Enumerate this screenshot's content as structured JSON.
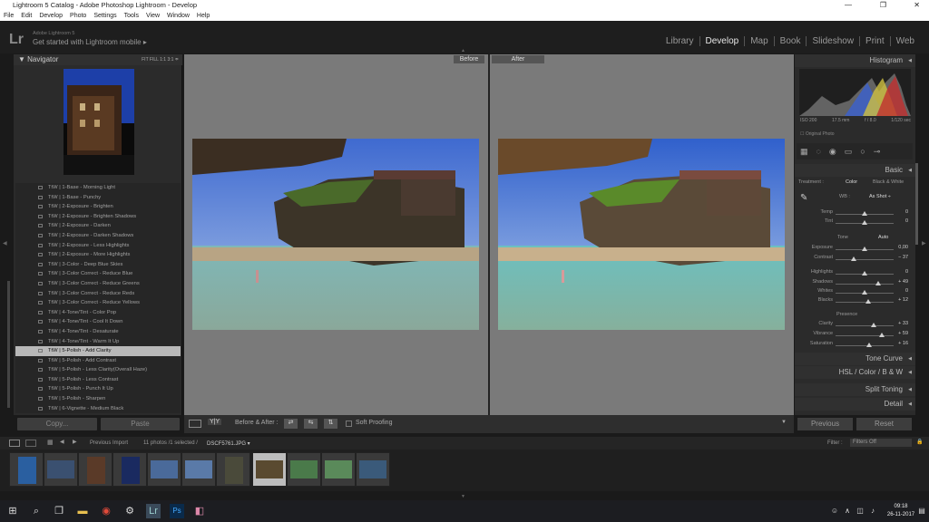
{
  "window": {
    "title": "Lightroom 5 Catalog - Adobe Photoshop Lightroom - Develop"
  },
  "menu": [
    "File",
    "Edit",
    "Develop",
    "Photo",
    "Settings",
    "Tools",
    "View",
    "Window",
    "Help"
  ],
  "identity": {
    "logo": "Lr",
    "small": "Adobe Lightroom 5",
    "main": "Get started with Lightroom mobile ▸"
  },
  "modules": [
    "Library",
    "Develop",
    "Map",
    "Book",
    "Slideshow",
    "Print",
    "Web"
  ],
  "navigator": {
    "title": "Navigator",
    "options": "FIT   FILL   1:1   3:1 ≑"
  },
  "presets": [
    "TtW | 1-Base - Morning Light",
    "TtW | 1-Base - Punchy",
    "TtW | 2-Exposure - Brighten",
    "TtW | 2-Exposure - Brighten Shadows",
    "TtW | 2-Exposure - Darken",
    "TtW | 2-Exposure - Darken Shadows",
    "TtW | 2-Exposure - Less Highlights",
    "TtW | 2-Exposure - More Highlights",
    "TtW | 3-Color - Deep Blue Skies",
    "TtW | 3-Color Correct - Reduce Blue",
    "TtW | 3-Color Correct - Reduce Greens",
    "TtW | 3-Color Correct - Reduce Reds",
    "TtW | 3-Color Correct - Reduce Yellows",
    "TtW | 4-Tone/Tint - Color Pop",
    "TtW | 4-Tone/Tint - Cool It Down",
    "TtW | 4-Tone/Tint - Desaturate",
    "TtW | 4-Tone/Tint - Warm It Up",
    "TtW | 5-Polish - Add Clarity",
    "TtW | 5-Polish - Add Contrast",
    "TtW | 5-Polish - Less Clarity(Overall Haze)",
    "TtW | 5-Polish - Less Contrast",
    "TtW | 5-Polish - Punch It Up",
    "TtW | 5-Polish - Sharpen",
    "TtW | 6-Vignette - Medium Black"
  ],
  "selected_preset": "TtW | 5-Polish - Add Clarity",
  "left_buttons": {
    "copy": "Copy...",
    "paste": "Paste"
  },
  "view_labels": {
    "before": "Before",
    "after": "After"
  },
  "toolbar": {
    "mode": "Y|Y",
    "before_after": "Before & After :",
    "soft_proofing": "Soft Proofing"
  },
  "histogram": {
    "title": "Histogram",
    "iso": "ISO 200",
    "focal": "17.5 mm",
    "aperture": "f / 8.0",
    "shutter": "1/120 sec",
    "original_photo": "Original Photo"
  },
  "basic": {
    "title": "Basic",
    "treatment_label": "Treatment :",
    "treatment_color": "Color",
    "treatment_bw": "Black & White",
    "wb_label": "WB :",
    "wb_value": "As Shot ÷",
    "tone_label": "Tone",
    "auto_label": "Auto",
    "presence_label": "Presence"
  },
  "sliders": [
    {
      "label": "Temp",
      "value": "0",
      "pos": 0.5
    },
    {
      "label": "Tint",
      "value": "0",
      "pos": 0.5
    },
    {
      "label": "Exposure",
      "value": "0,00",
      "pos": 0.5
    },
    {
      "label": "Contrast",
      "value": "− 37",
      "pos": 0.31
    },
    {
      "label": "Highlights",
      "value": "0",
      "pos": 0.5
    },
    {
      "label": "Shadows",
      "value": "+ 49",
      "pos": 0.74
    },
    {
      "label": "Whites",
      "value": "0",
      "pos": 0.5
    },
    {
      "label": "Blacks",
      "value": "+ 12",
      "pos": 0.56
    },
    {
      "label": "Clarity",
      "value": "+ 33",
      "pos": 0.66
    },
    {
      "label": "Vibrance",
      "value": "+ 59",
      "pos": 0.79
    },
    {
      "label": "Saturation",
      "value": "+ 16",
      "pos": 0.58
    }
  ],
  "panels": {
    "tone_curve": "Tone Curve",
    "hsl": "HSL  /  Color  /  B & W",
    "split_toning": "Split Toning",
    "detail": "Detail"
  },
  "right_buttons": {
    "previous": "Previous",
    "reset": "Reset"
  },
  "filmstrip_bar": {
    "source": "Previous Import",
    "count": "11 photos /1 selected /",
    "filename": "DSCF5761.JPG ▾",
    "filter_label": "Filter :",
    "filter_value": "Filters Off"
  },
  "clock": {
    "time": "09:18",
    "date": "26-11-2017"
  },
  "colors": {
    "accent": "#e8e8e8",
    "panel": "#2b2b2b",
    "center_bg": "#7a7a7a"
  }
}
